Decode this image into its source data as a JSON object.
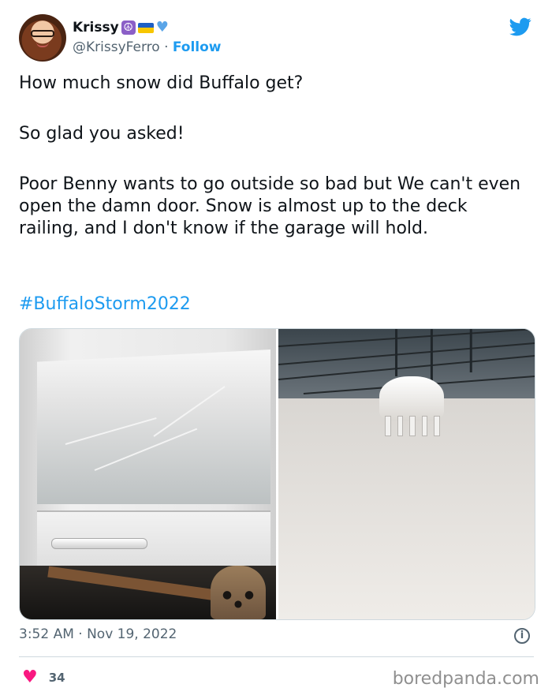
{
  "tweet": {
    "display_name": "Krissy",
    "handle": "@KrissyFerro",
    "separator": "·",
    "follow_label": "Follow",
    "paragraphs": [
      "How much snow did Buffalo get?",
      "So glad you asked!",
      "Poor Benny wants to go outside so bad but We can't even open the damn door. Snow is almost up to the deck railing, and I don't know if the garage will hold."
    ],
    "hashtag": "#BuffaloStorm2022",
    "timestamp": "3:52 AM · Nov 19, 2022",
    "likes": "34"
  },
  "icons": {
    "name_emojis": [
      "peace-symbol-emoji",
      "ukraine-flag-emoji",
      "blue-heart-emoji"
    ],
    "brand": "twitter-bird-icon",
    "info": "info-icon",
    "like": "heart-icon"
  },
  "watermark": "boredpanda.com",
  "colors": {
    "link": "#1d9bf0",
    "secondary_text": "#536471",
    "like": "#f91880",
    "twitter_blue": "#1d9bf0"
  }
}
